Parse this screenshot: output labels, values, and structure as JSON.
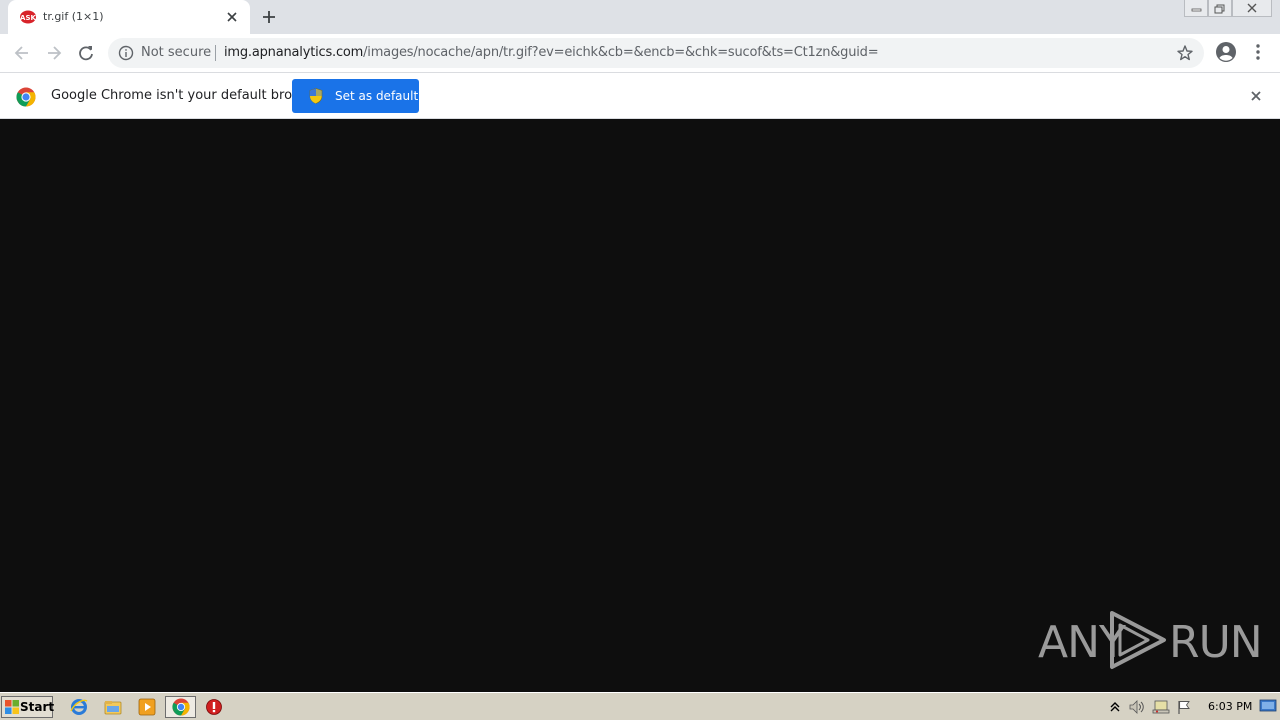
{
  "tab": {
    "title": "tr.gif (1×1)",
    "favicon": "ask-icon"
  },
  "toolbar": {
    "security_label": "Not secure",
    "url_host": "img.apnanalytics.com",
    "url_path": "/images/nocache/apn/tr.gif?ev=eichk&cb=&encb=&chk=sucof&ts=Ct1zn&guid="
  },
  "infobar": {
    "message": "Google Chrome isn't your default browser",
    "button_label": "Set as default"
  },
  "watermark": {
    "left": "ANY",
    "right": "RUN"
  },
  "taskbar": {
    "start_label": "Start",
    "clock": "6:03 PM"
  },
  "colors": {
    "accent": "#1a73e8",
    "content_bg": "#0e0e0e",
    "taskbar": "#d6d2c4"
  }
}
